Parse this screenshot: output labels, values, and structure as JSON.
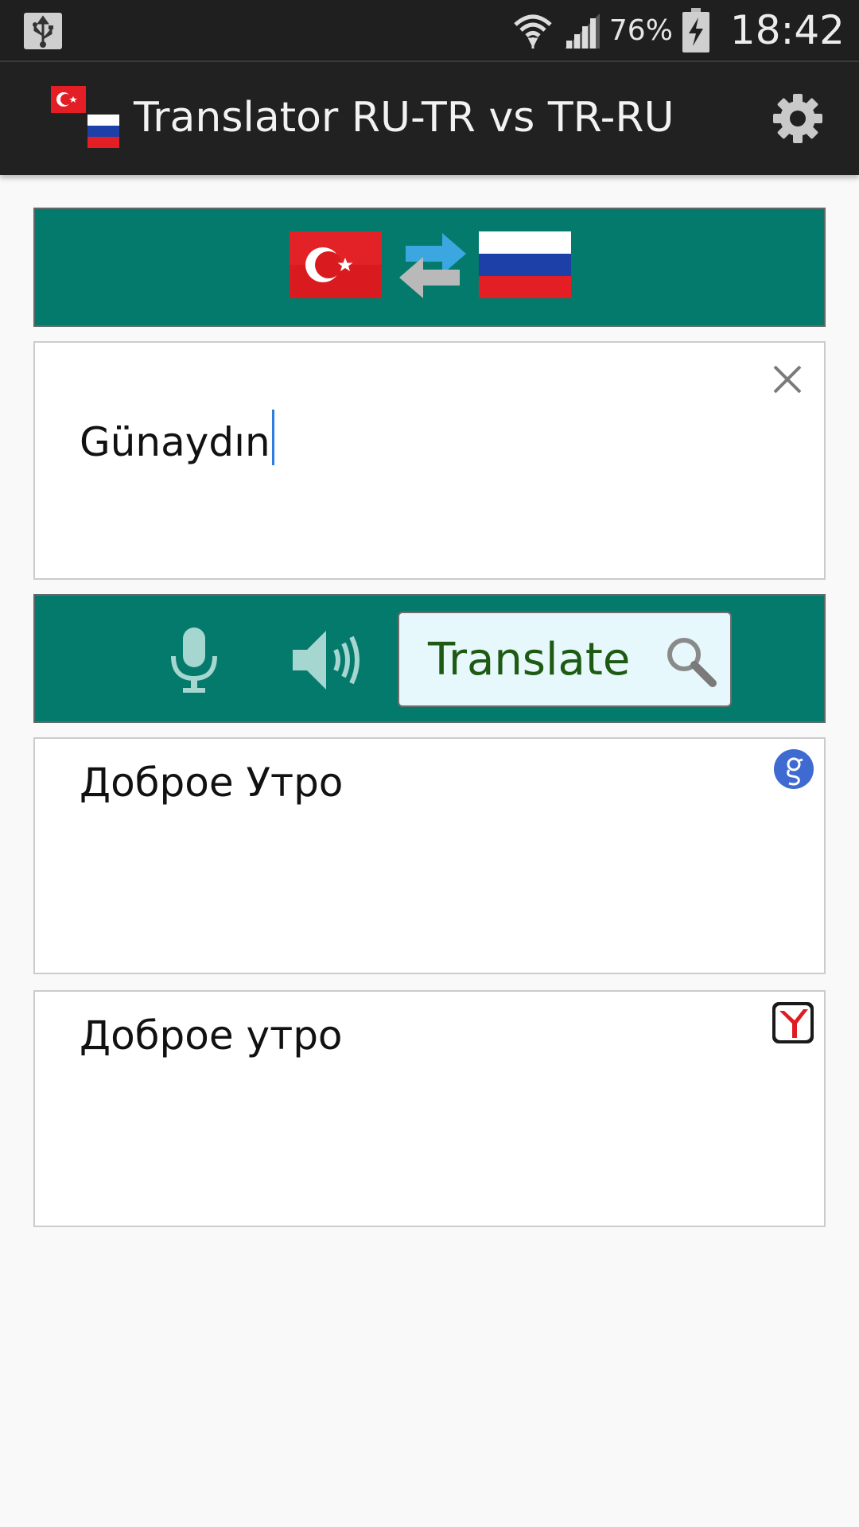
{
  "status_bar": {
    "battery_percent": "76%",
    "time": "18:42",
    "icons": [
      "usb-icon",
      "wifi-icon",
      "signal-icon",
      "battery-charging-icon"
    ]
  },
  "app_bar": {
    "title": "Translator RU-TR vs TR-RU",
    "icons": [
      "flags-app-icon",
      "gear-icon"
    ]
  },
  "language_bar": {
    "source_language": "tr",
    "target_language": "ru",
    "icons": [
      "turkey-flag-icon",
      "swap-arrows-icon",
      "russia-flag-icon"
    ]
  },
  "input": {
    "value": "Günaydın",
    "icons": [
      "close-icon"
    ]
  },
  "actions": {
    "translate_label": "Translate",
    "icons": [
      "microphone-icon",
      "speaker-icon",
      "search-icon"
    ]
  },
  "results": [
    {
      "provider": "google",
      "text": "Доброе Утро",
      "icon": "google-icon"
    },
    {
      "provider": "yandex",
      "text": "Доброе утро",
      "icon": "yandex-icon"
    }
  ],
  "colors": {
    "toolbar_teal": "#047a6c",
    "app_bar": "#212121",
    "translate_bg": "#e6f8fc",
    "translate_text": "#1e5a12"
  }
}
